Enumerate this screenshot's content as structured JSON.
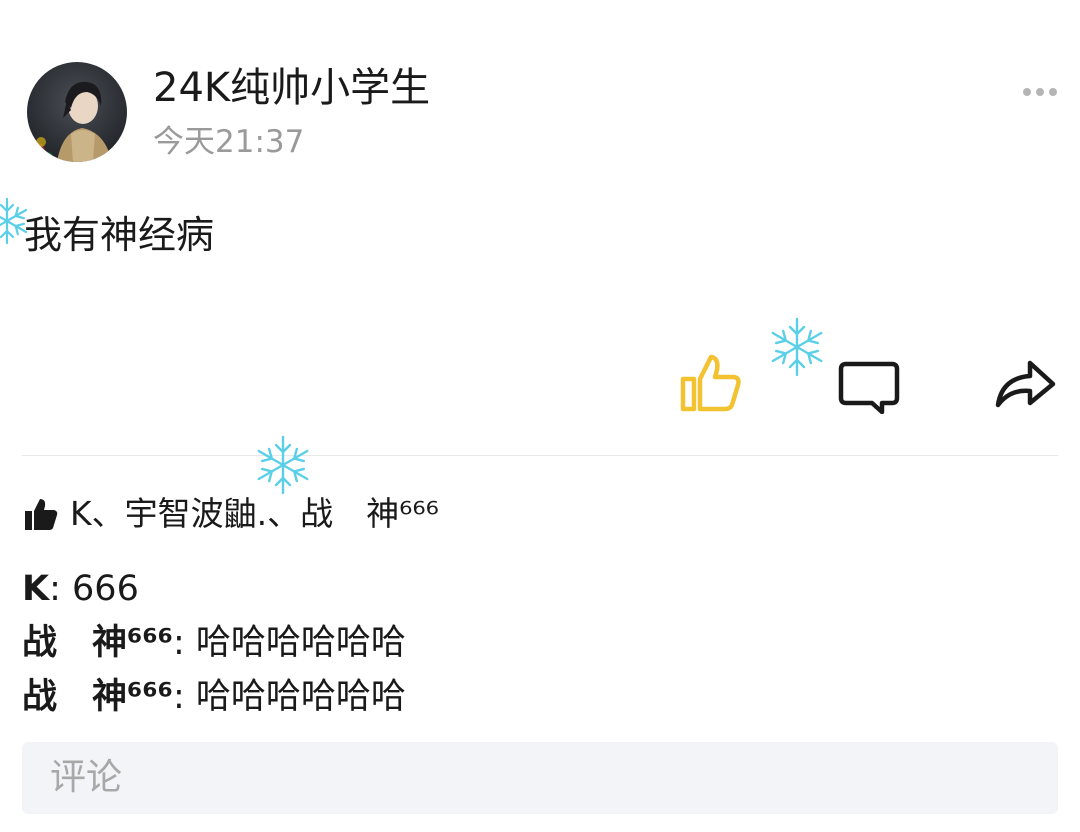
{
  "post": {
    "username": "24K纯帅小学生",
    "time": "今天21:37",
    "content": "我有神经病"
  },
  "icons": {
    "more": "more-dots-icon",
    "like": "thumbs-up-outline-icon",
    "comment": "comment-bubble-icon",
    "share": "share-arrow-icon",
    "likes_row": "thumbs-up-filled-icon",
    "decoration": "snowflake-icon"
  },
  "colors": {
    "like_accent": "#f2c230",
    "username": "#1a1a1a",
    "timestamp": "#9a9a9a",
    "placeholder": "#a8a8a8",
    "input_bg": "#f3f4f7",
    "snowflake": "#5bcfe8"
  },
  "likes": {
    "names": "K、宇智波鼬.、战　神⁶⁶⁶"
  },
  "comments": [
    {
      "author": "K",
      "text": ": 666"
    },
    {
      "author": "战　神⁶⁶⁶",
      "text": ": 哈哈哈哈哈哈"
    },
    {
      "author": "战　神⁶⁶⁶",
      "text": ": 哈哈哈哈哈哈"
    }
  ],
  "comment_input": {
    "placeholder": "评论"
  }
}
